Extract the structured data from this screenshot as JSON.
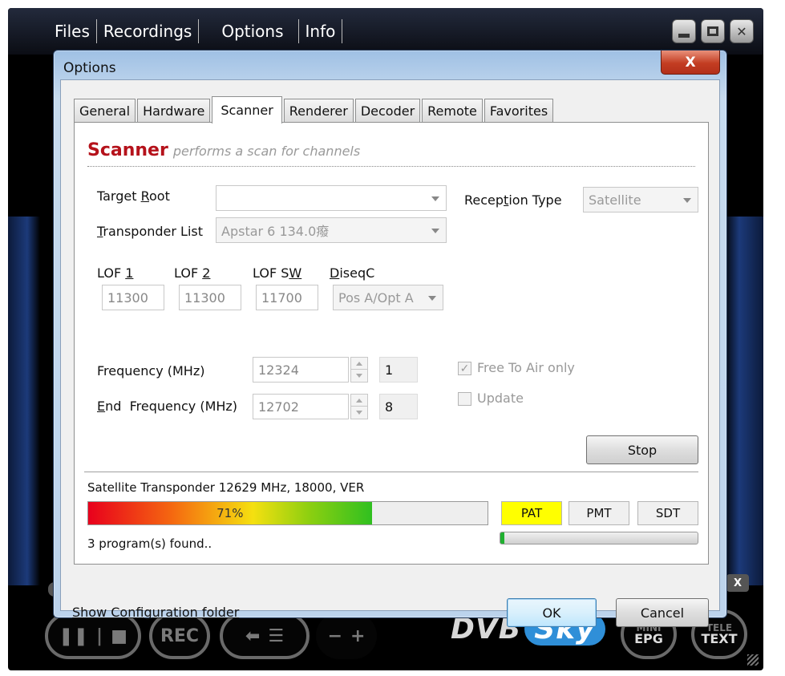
{
  "player": {
    "menu": [
      "Files",
      "Recordings",
      "Options",
      "Info"
    ],
    "controls": {
      "rec_label": "REC",
      "minus": "−",
      "plus": "+",
      "logo_main": "DVB",
      "logo_sub": "Sky",
      "epg_top": "MINI",
      "epg_bottom": "EPG",
      "text_top": "TELE",
      "text_bottom": "TEXT",
      "x_badge": "X"
    }
  },
  "dialog": {
    "title": "Options",
    "close_label": "X",
    "tabs": [
      "General",
      "Hardware",
      "Scanner",
      "Renderer",
      "Decoder",
      "Remote",
      "Favorites"
    ],
    "active_tab": "Scanner",
    "heading_main": "Scanner",
    "heading_sub": "performs a scan for channels",
    "target_root": {
      "label_pre": "Target ",
      "label_acc": "R",
      "label_post": "oot",
      "value": ""
    },
    "reception_type": {
      "label_pre": "Recep",
      "label_acc": "t",
      "label_post": "ion Type",
      "value": "Satellite"
    },
    "transponder_list": {
      "label_pre": "",
      "label_acc": "T",
      "label_post": "ransponder List",
      "value": "Apstar 6 134.0癈"
    },
    "lof1": {
      "label_pre": "LOF ",
      "label_acc": "1",
      "value": "11300"
    },
    "lof2": {
      "label_pre": "LOF ",
      "label_acc": "2",
      "value": "11300"
    },
    "lofsw": {
      "label_pre": "LOF S",
      "label_acc": "W",
      "value": "11700"
    },
    "diseqc": {
      "label_acc": "D",
      "label_post": "iseqC",
      "value": "Pos A/Opt A"
    },
    "frequency": {
      "label": "Frequency (MHz)",
      "value": "12324",
      "step": "1"
    },
    "end_frequency": {
      "label_acc": "E",
      "label_post": "nd  Frequency (MHz)",
      "value": "12702",
      "step": "8"
    },
    "free_to_air": {
      "label": "Free To Air only",
      "checked": true,
      "check_glyph": "✓"
    },
    "update": {
      "label": "Update",
      "checked": false
    },
    "stop_button": "Stop",
    "status_text": "Satellite Transponder 12629 MHz, 18000, VER",
    "progress": {
      "value": 71,
      "label": "71%"
    },
    "tables": {
      "pat": "PAT",
      "pmt": "PMT",
      "sdt": "SDT",
      "active": "PAT",
      "active_color": "#ffff00"
    },
    "signal_level": 0.02,
    "programs_found": "3 program(s) found..",
    "show_config_link": "Show Configuration folder",
    "ok_button": "OK",
    "cancel_button": "Cancel"
  }
}
